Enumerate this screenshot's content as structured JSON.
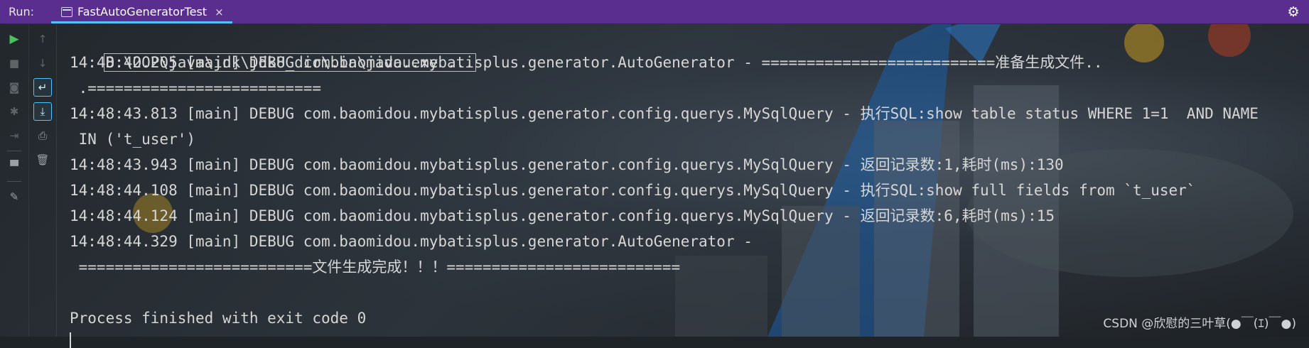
{
  "window": {
    "run_label": "Run:",
    "tab_title": "FastAutoGeneratorTest",
    "tab_close": "×"
  },
  "toolbar": {
    "left_column": [
      {
        "icon": "run-icon",
        "glyph": "▶"
      },
      {
        "icon": "stop-icon",
        "glyph": "■"
      },
      {
        "icon": "camera-icon",
        "glyph": "◙"
      },
      {
        "icon": "bug-icon",
        "glyph": "✱"
      },
      {
        "icon": "exit-icon",
        "glyph": "⇥"
      },
      {
        "icon": "layout-icon",
        "glyph": "▀"
      },
      {
        "icon": "pin-icon",
        "glyph": "✎"
      }
    ],
    "right_column": [
      {
        "icon": "up-arrow-icon",
        "glyph": "↑"
      },
      {
        "icon": "down-arrow-icon",
        "glyph": "↓"
      },
      {
        "icon": "soft-wrap-icon",
        "glyph": "↵"
      },
      {
        "icon": "scroll-to-end-icon",
        "glyph": "⤓"
      },
      {
        "icon": "print-icon",
        "glyph": "⎙"
      },
      {
        "icon": "trash-icon",
        "glyph": "🗑"
      }
    ]
  },
  "console": {
    "command": "D:\\OOP\\java\\jdk\\jdk8_dir\\bin\\java.exe ...",
    "lines": [
      "14:48:42.205 [main] DEBUG com.baomidou.mybatisplus.generator.AutoGenerator - ==========================准备生成文件..",
      " .==========================",
      "14:48:43.813 [main] DEBUG com.baomidou.mybatisplus.generator.config.querys.MySqlQuery - 执行SQL:show table status WHERE 1=1  AND NAME",
      " IN ('t_user')",
      "14:48:43.943 [main] DEBUG com.baomidou.mybatisplus.generator.config.querys.MySqlQuery - 返回记录数:1,耗时(ms):130",
      "14:48:44.108 [main] DEBUG com.baomidou.mybatisplus.generator.config.querys.MySqlQuery - 执行SQL:show full fields from `t_user`",
      "14:48:44.124 [main] DEBUG com.baomidou.mybatisplus.generator.config.querys.MySqlQuery - 返回记录数:6,耗时(ms):15",
      "14:48:44.329 [main] DEBUG com.baomidou.mybatisplus.generator.AutoGenerator -",
      " ==========================文件生成完成！！！==========================",
      "",
      "Process finished with exit code 0"
    ]
  },
  "watermark": "CSDN @欣慰的三叶草(●￣(ｴ)￣●)",
  "colors": {
    "title_bar": "#5a2e8f",
    "tab_underline": "#4fc3f7",
    "console_text": "#d6d6d6",
    "run_green": "#49c25a"
  }
}
